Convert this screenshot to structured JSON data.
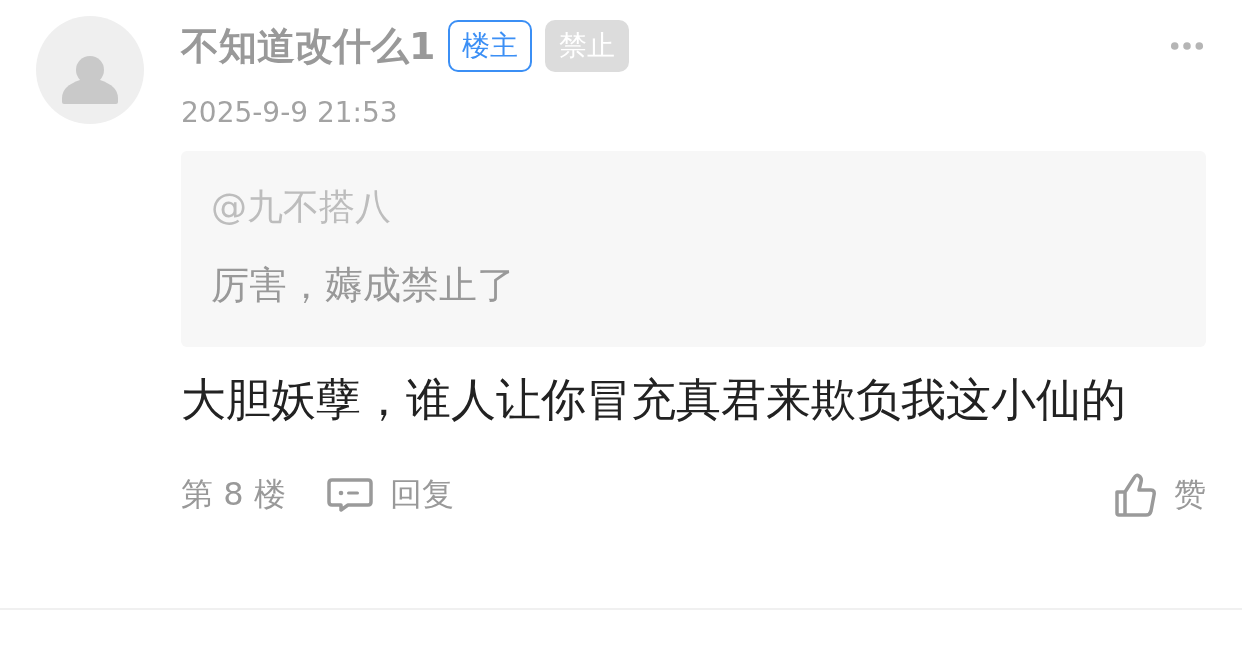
{
  "author": {
    "name": "不知道改什么1",
    "badges": [
      {
        "kind": "owner",
        "label": "楼主"
      },
      {
        "kind": "muted",
        "label": "禁止"
      }
    ]
  },
  "date": "2025-9-9 21:53",
  "quote": {
    "mention": "@九不搭八",
    "text": "厉害，薅成禁止了"
  },
  "content": "大胆妖孽，谁人让你冒充真君来欺负我这小仙的",
  "footer": {
    "floor": "第 8 楼",
    "reply": "回复",
    "like": "赞"
  }
}
